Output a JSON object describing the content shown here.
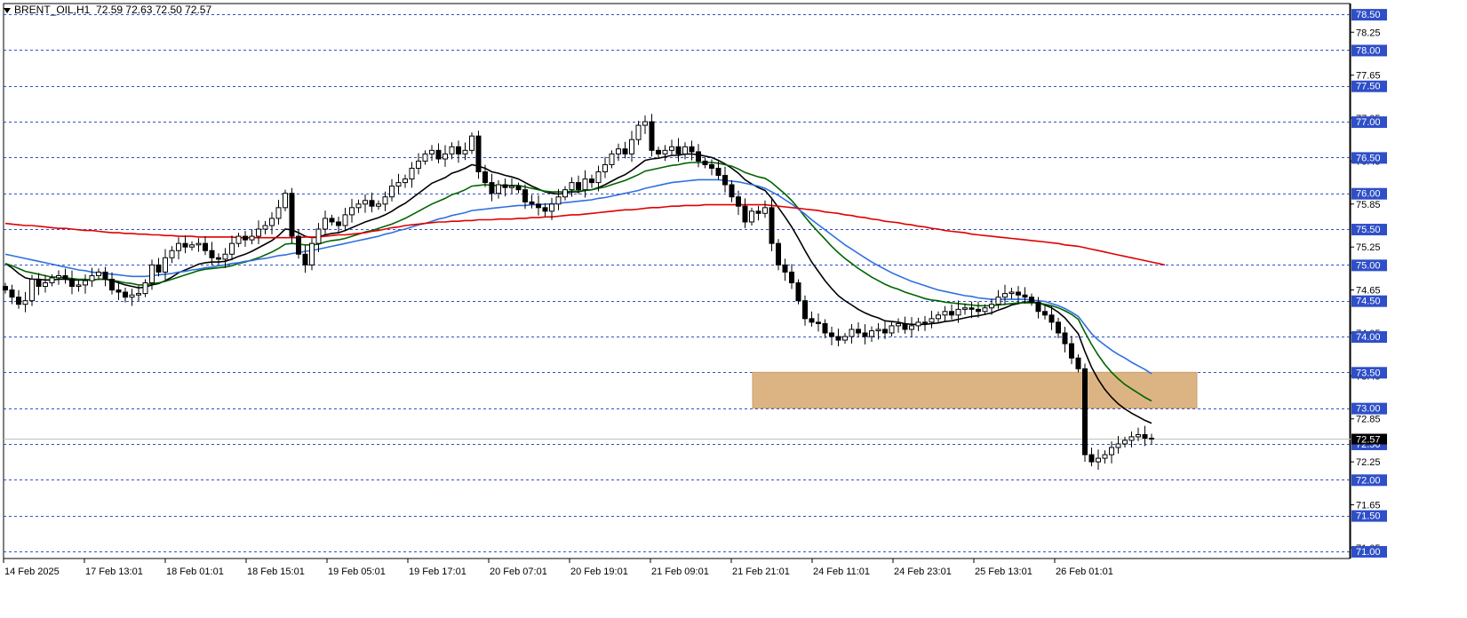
{
  "header": {
    "symbol": "BRENT_OIL,H1",
    "ohlc": "72.59 72.63 72.50 72.57"
  },
  "chart_data": {
    "type": "candlestick",
    "timeframe": "H1",
    "ylim": [
      70.9,
      78.65
    ],
    "price_labels": [
      "78.25",
      "77.65",
      "77.05",
      "76.45",
      "75.85",
      "75.25",
      "74.65",
      "74.05",
      "73.45",
      "72.85",
      "72.25",
      "71.65",
      "71.05"
    ],
    "level_lines": [
      "78.50",
      "78.00",
      "77.50",
      "77.00",
      "76.50",
      "76.00",
      "75.50",
      "75.00",
      "74.50",
      "74.00",
      "73.50",
      "73.00",
      "72.50",
      "72.00",
      "71.50",
      "71.00"
    ],
    "current_price": "72.57",
    "time_labels": [
      "14 Feb 2025",
      "17 Feb 13:01",
      "18 Feb 01:01",
      "18 Feb 15:01",
      "19 Feb 05:01",
      "19 Feb 17:01",
      "20 Feb 07:01",
      "20 Feb 19:01",
      "21 Feb 09:01",
      "21 Feb 21:01",
      "24 Feb 11:01",
      "24 Feb 23:01",
      "25 Feb 13:01",
      "26 Feb 01:01"
    ],
    "zone": {
      "low": 73.0,
      "high": 73.5
    },
    "close": [
      74.65,
      74.55,
      74.45,
      74.5,
      74.8,
      74.7,
      74.75,
      74.82,
      74.85,
      74.8,
      74.7,
      74.72,
      74.78,
      74.85,
      74.9,
      74.8,
      74.65,
      74.62,
      74.55,
      74.58,
      74.6,
      74.75,
      75.0,
      74.9,
      75.1,
      75.2,
      75.3,
      75.25,
      75.28,
      75.3,
      75.2,
      75.1,
      75.08,
      75.15,
      75.3,
      75.4,
      75.35,
      75.4,
      75.5,
      75.55,
      75.65,
      75.8,
      76.0,
      75.4,
      75.15,
      75.0,
      75.3,
      75.5,
      75.65,
      75.6,
      75.55,
      75.7,
      75.8,
      75.85,
      75.9,
      75.82,
      75.85,
      75.95,
      76.1,
      76.15,
      76.2,
      76.35,
      76.45,
      76.55,
      76.6,
      76.48,
      76.55,
      76.65,
      76.55,
      76.6,
      76.8,
      76.3,
      76.15,
      76.0,
      76.12,
      76.08,
      76.1,
      76.05,
      75.88,
      75.85,
      75.8,
      75.75,
      75.85,
      75.95,
      76.05,
      76.15,
      76.05,
      76.2,
      76.15,
      76.3,
      76.4,
      76.55,
      76.62,
      76.55,
      76.75,
      76.95,
      77.0,
      76.6,
      76.55,
      76.6,
      76.65,
      76.55,
      76.65,
      76.58,
      76.45,
      76.4,
      76.35,
      76.25,
      76.12,
      75.95,
      75.82,
      75.6,
      75.75,
      75.72,
      75.8,
      75.3,
      75.0,
      74.9,
      74.75,
      74.5,
      74.25,
      74.2,
      74.18,
      74.05,
      74.0,
      73.95,
      74.0,
      74.1,
      74.05,
      74.0,
      74.08,
      74.1,
      74.05,
      74.15,
      74.18,
      74.1,
      74.15,
      74.2,
      74.2,
      74.25,
      74.3,
      74.35,
      74.3,
      74.38,
      74.4,
      74.38,
      74.35,
      74.4,
      74.45,
      74.55,
      74.6,
      74.62,
      74.58,
      74.55,
      74.48,
      74.35,
      74.3,
      74.2,
      74.05,
      73.9,
      73.7,
      73.55,
      72.35,
      72.25,
      72.3,
      72.35,
      72.45,
      72.5,
      72.55,
      72.6,
      72.63,
      72.58,
      72.57
    ],
    "moving_averages": [
      {
        "color": "#000000",
        "values": [
          75.02,
          74.96,
          74.88,
          74.82,
          74.8,
          74.8,
          74.79,
          74.79,
          74.8,
          74.8,
          74.79,
          74.79,
          74.79,
          74.79,
          74.8,
          74.8,
          74.78,
          74.75,
          74.72,
          74.7,
          74.68,
          74.69,
          74.72,
          74.74,
          74.78,
          74.83,
          74.89,
          74.93,
          74.97,
          75.01,
          75.03,
          75.04,
          75.04,
          75.05,
          75.08,
          75.12,
          75.15,
          75.19,
          75.24,
          75.29,
          75.34,
          75.41,
          75.5,
          75.49,
          75.45,
          75.4,
          75.38,
          75.39,
          75.42,
          75.44,
          75.45,
          75.48,
          75.52,
          75.56,
          75.6,
          75.63,
          75.66,
          75.7,
          75.75,
          75.81,
          75.86,
          75.93,
          76.0,
          76.07,
          76.14,
          76.18,
          76.22,
          76.28,
          76.31,
          76.35,
          76.4,
          76.38,
          76.35,
          76.3,
          76.28,
          76.25,
          76.23,
          76.2,
          76.15,
          76.1,
          76.06,
          76.02,
          76.0,
          75.99,
          76.0,
          76.02,
          76.02,
          76.04,
          76.05,
          76.08,
          76.12,
          76.17,
          76.22,
          76.26,
          76.32,
          76.39,
          76.46,
          76.48,
          76.49,
          76.51,
          76.53,
          76.53,
          76.55,
          76.55,
          76.54,
          76.52,
          76.5,
          76.46,
          76.41,
          76.35,
          76.28,
          76.19,
          76.13,
          76.08,
          76.04,
          75.93,
          75.8,
          75.67,
          75.53,
          75.37,
          75.2,
          75.04,
          74.91,
          74.78,
          74.67,
          74.57,
          74.5,
          74.44,
          74.38,
          74.33,
          74.29,
          74.26,
          74.22,
          74.21,
          74.2,
          74.18,
          74.17,
          74.17,
          74.17,
          74.18,
          74.19,
          74.21,
          74.22,
          74.24,
          74.26,
          74.28,
          74.29,
          74.31,
          74.33,
          74.37,
          74.4,
          74.44,
          74.46,
          74.48,
          74.48,
          74.47,
          74.44,
          74.4,
          74.34,
          74.26,
          74.15,
          74.04,
          73.79,
          73.57,
          73.4,
          73.26,
          73.15,
          73.06,
          72.99,
          72.93,
          72.88,
          72.83,
          72.79
        ]
      },
      {
        "color": "#006400",
        "values": [
          75.02,
          74.99,
          74.95,
          74.91,
          74.89,
          74.87,
          74.85,
          74.83,
          74.83,
          74.82,
          74.81,
          74.8,
          74.8,
          74.79,
          74.8,
          74.8,
          74.79,
          74.77,
          74.75,
          74.74,
          74.72,
          74.72,
          74.74,
          74.75,
          74.77,
          74.8,
          74.83,
          74.86,
          74.89,
          74.92,
          74.94,
          74.95,
          74.96,
          74.97,
          74.99,
          75.02,
          75.04,
          75.07,
          75.1,
          75.14,
          75.18,
          75.23,
          75.29,
          75.3,
          75.29,
          75.28,
          75.28,
          75.29,
          75.32,
          75.34,
          75.35,
          75.37,
          75.4,
          75.43,
          75.46,
          75.48,
          75.51,
          75.54,
          75.57,
          75.61,
          75.65,
          75.7,
          75.75,
          75.8,
          75.85,
          75.89,
          75.93,
          75.98,
          76.01,
          76.05,
          76.1,
          76.11,
          76.12,
          76.11,
          76.11,
          76.11,
          76.11,
          76.11,
          76.09,
          76.07,
          76.05,
          76.03,
          76.02,
          76.02,
          76.02,
          76.03,
          76.03,
          76.04,
          76.05,
          76.07,
          76.09,
          76.12,
          76.15,
          76.18,
          76.22,
          76.26,
          76.31,
          76.33,
          76.35,
          76.37,
          76.39,
          76.4,
          76.42,
          76.43,
          76.43,
          76.43,
          76.43,
          76.42,
          76.4,
          76.38,
          76.34,
          76.29,
          76.26,
          76.23,
          76.21,
          76.15,
          76.07,
          75.99,
          75.9,
          75.79,
          75.67,
          75.56,
          75.46,
          75.36,
          75.26,
          75.17,
          75.09,
          75.02,
          74.95,
          74.89,
          74.83,
          74.78,
          74.73,
          74.69,
          74.66,
          74.62,
          74.59,
          74.56,
          74.53,
          74.51,
          74.5,
          74.48,
          74.47,
          74.46,
          74.45,
          74.44,
          74.43,
          74.43,
          74.43,
          74.44,
          74.45,
          74.46,
          74.47,
          74.47,
          74.47,
          74.47,
          74.45,
          74.43,
          74.4,
          74.36,
          74.31,
          74.24,
          74.06,
          73.89,
          73.74,
          73.61,
          73.5,
          73.41,
          73.33,
          73.27,
          73.21,
          73.15,
          73.1
        ]
      },
      {
        "color": "#2f6fe0",
        "values": [
          75.15,
          75.13,
          75.11,
          75.09,
          75.07,
          75.05,
          75.03,
          75.01,
          74.99,
          74.97,
          74.95,
          74.93,
          74.92,
          74.9,
          74.89,
          74.88,
          74.87,
          74.86,
          74.85,
          74.84,
          74.84,
          74.84,
          74.85,
          74.86,
          74.87,
          74.88,
          74.9,
          74.91,
          74.93,
          74.94,
          74.96,
          74.97,
          74.99,
          75.0,
          75.02,
          75.03,
          75.05,
          75.06,
          75.08,
          75.09,
          75.11,
          75.13,
          75.14,
          75.16,
          75.17,
          75.19,
          75.2,
          75.22,
          75.24,
          75.26,
          75.28,
          75.3,
          75.32,
          75.34,
          75.36,
          75.38,
          75.4,
          75.43,
          75.45,
          75.48,
          75.5,
          75.53,
          75.56,
          75.58,
          75.61,
          75.64,
          75.66,
          75.69,
          75.71,
          75.73,
          75.76,
          75.77,
          75.78,
          75.79,
          75.8,
          75.81,
          75.82,
          75.83,
          75.83,
          75.84,
          75.84,
          75.85,
          75.85,
          75.86,
          75.87,
          75.88,
          75.89,
          75.9,
          75.91,
          75.93,
          75.94,
          75.96,
          75.98,
          76.0,
          76.02,
          76.04,
          76.07,
          76.09,
          76.11,
          76.13,
          76.15,
          76.16,
          76.17,
          76.18,
          76.19,
          76.19,
          76.19,
          76.19,
          76.18,
          76.17,
          76.16,
          76.14,
          76.12,
          76.1,
          76.07,
          76.02,
          75.97,
          75.91,
          75.85,
          75.78,
          75.71,
          75.63,
          75.56,
          75.49,
          75.42,
          75.35,
          75.28,
          75.22,
          75.16,
          75.1,
          75.04,
          74.99,
          74.94,
          74.89,
          74.85,
          74.81,
          74.77,
          74.74,
          74.71,
          74.68,
          74.65,
          74.63,
          74.61,
          74.59,
          74.57,
          74.56,
          74.54,
          74.53,
          74.52,
          74.52,
          74.52,
          74.52,
          74.52,
          74.52,
          74.51,
          74.5,
          74.49,
          74.46,
          74.43,
          74.39,
          74.34,
          74.28,
          74.16,
          74.04,
          73.95,
          73.88,
          73.81,
          73.75,
          73.7,
          73.64,
          73.59,
          73.54,
          73.48
        ]
      },
      {
        "color": "#e00000",
        "values": [
          75.58,
          75.57,
          75.56,
          75.55,
          75.55,
          75.54,
          75.53,
          75.52,
          75.51,
          75.51,
          75.5,
          75.49,
          75.48,
          75.48,
          75.47,
          75.46,
          75.45,
          75.45,
          75.44,
          75.44,
          75.43,
          75.43,
          75.42,
          75.42,
          75.41,
          75.41,
          75.4,
          75.4,
          75.4,
          75.39,
          75.39,
          75.39,
          75.39,
          75.39,
          75.39,
          75.38,
          75.38,
          75.38,
          75.38,
          75.38,
          75.38,
          75.38,
          75.38,
          75.38,
          75.38,
          75.39,
          75.39,
          75.39,
          75.4,
          75.41,
          75.42,
          75.42,
          75.43,
          75.44,
          75.45,
          75.47,
          75.48,
          75.5,
          75.52,
          75.53,
          75.55,
          75.56,
          75.57,
          75.58,
          75.59,
          75.6,
          75.6,
          75.61,
          75.61,
          75.62,
          75.62,
          75.63,
          75.63,
          75.63,
          75.64,
          75.64,
          75.64,
          75.65,
          75.65,
          75.66,
          75.66,
          75.67,
          75.67,
          75.68,
          75.69,
          75.7,
          75.7,
          75.71,
          75.72,
          75.73,
          75.74,
          75.75,
          75.76,
          75.77,
          75.77,
          75.78,
          75.79,
          75.8,
          75.8,
          75.81,
          75.82,
          75.82,
          75.83,
          75.83,
          75.83,
          75.84,
          75.84,
          75.84,
          75.84,
          75.84,
          75.84,
          75.84,
          75.84,
          75.84,
          75.84,
          75.83,
          75.82,
          75.81,
          75.8,
          75.79,
          75.78,
          75.77,
          75.76,
          75.74,
          75.73,
          75.72,
          75.7,
          75.69,
          75.67,
          75.66,
          75.64,
          75.63,
          75.61,
          75.6,
          75.59,
          75.57,
          75.56,
          75.54,
          75.53,
          75.51,
          75.5,
          75.48,
          75.47,
          75.46,
          75.45,
          75.43,
          75.42,
          75.41,
          75.4,
          75.39,
          75.38,
          75.37,
          75.36,
          75.35,
          75.34,
          75.33,
          75.32,
          75.31,
          75.3,
          75.28,
          75.27,
          75.26,
          75.24,
          75.22,
          75.2,
          75.18,
          75.16,
          75.14,
          75.12,
          75.1,
          75.08,
          75.06,
          75.04,
          75.02,
          75.0
        ]
      }
    ]
  }
}
